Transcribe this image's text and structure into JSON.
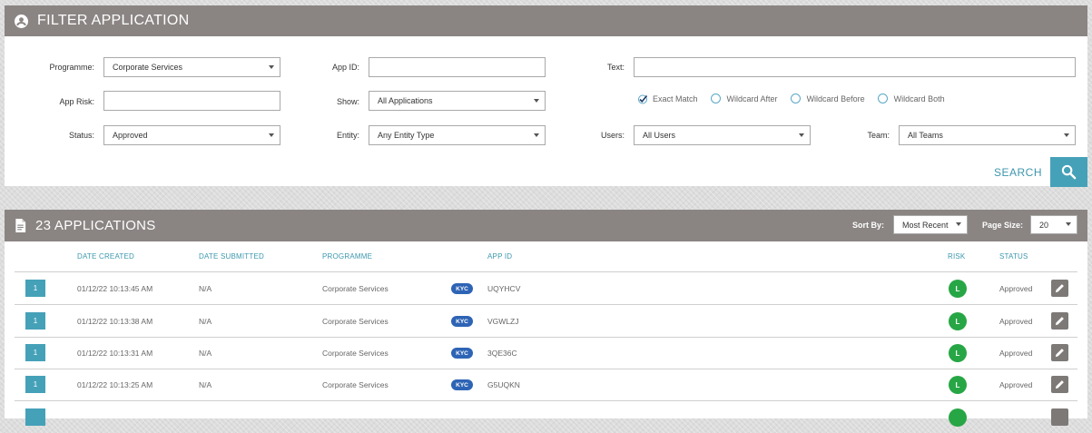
{
  "filter": {
    "title": "FILTER APPLICATION",
    "programme_label": "Programme:",
    "programme_value": "Corporate Services",
    "app_risk_label": "App Risk:",
    "app_risk_value": "",
    "status_label": "Status:",
    "status_value": "Approved",
    "app_id_label": "App ID:",
    "app_id_value": "",
    "show_label": "Show:",
    "show_value": "All Applications",
    "entity_label": "Entity:",
    "entity_value": "Any Entity Type",
    "text_label": "Text:",
    "text_value": "",
    "match_options": [
      "Exact Match",
      "Wildcard After",
      "Wildcard Before",
      "Wildcard Both"
    ],
    "match_selected": "Exact Match",
    "users_label": "Users:",
    "users_value": "All Users",
    "team_label": "Team:",
    "team_value": "All Teams",
    "search_label": "SEARCH"
  },
  "apps": {
    "title": "23 APPLICATIONS",
    "sort_by_label": "Sort By:",
    "sort_by_value": "Most Recent",
    "page_size_label": "Page Size:",
    "page_size_value": "20",
    "columns": {
      "date_created": "DATE CREATED",
      "date_submitted": "DATE SUBMITTED",
      "programme": "PROGRAMME",
      "app_id": "APP ID",
      "risk": "RISK",
      "status": "STATUS"
    },
    "rows": [
      {
        "num": "1",
        "date_created": "01/12/22 10:13:45 AM",
        "date_submitted": "N/A",
        "programme": "Corporate Services",
        "badge": "KYC",
        "app_id": "UQYHCV",
        "risk": "L",
        "status": "Approved"
      },
      {
        "num": "1",
        "date_created": "01/12/22 10:13:38 AM",
        "date_submitted": "N/A",
        "programme": "Corporate Services",
        "badge": "KYC",
        "app_id": "VGWLZJ",
        "risk": "L",
        "status": "Approved"
      },
      {
        "num": "1",
        "date_created": "01/12/22 10:13:31 AM",
        "date_submitted": "N/A",
        "programme": "Corporate Services",
        "badge": "KYC",
        "app_id": "3QE36C",
        "risk": "L",
        "status": "Approved"
      },
      {
        "num": "1",
        "date_created": "01/12/22 10:13:25 AM",
        "date_submitted": "N/A",
        "programme": "Corporate Services",
        "badge": "KYC",
        "app_id": "G5UQKN",
        "risk": "L",
        "status": "Approved"
      }
    ]
  },
  "colors": {
    "header_bg": "#8a8583",
    "accent": "#45a1b8",
    "badge_blue": "#2e64b5",
    "risk_green": "#27a645"
  }
}
